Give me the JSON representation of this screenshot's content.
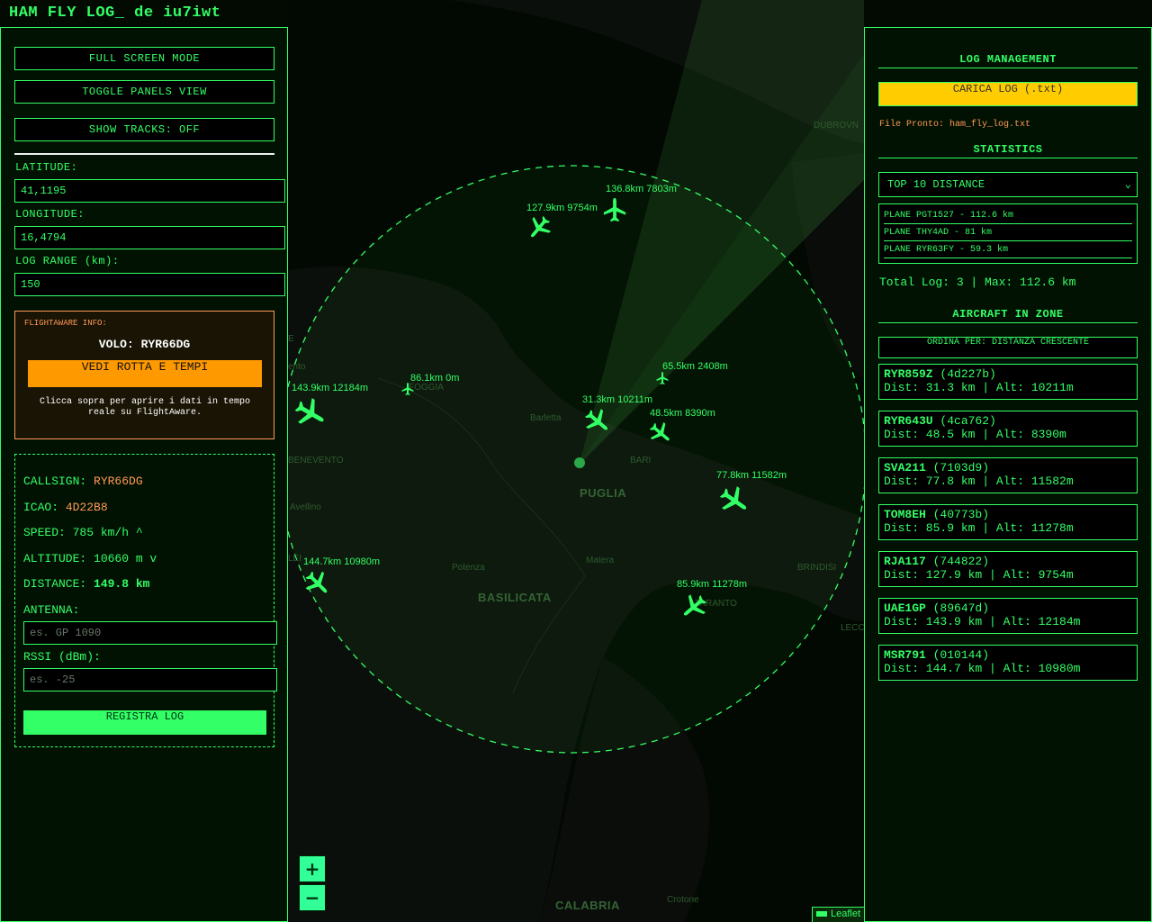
{
  "app": {
    "title": "HAM FLY LOG_ de iu7iwt"
  },
  "left": {
    "full_screen": "FULL SCREEN MODE",
    "toggle_panels": "TOGGLE PANELS VIEW",
    "show_tracks": "SHOW TRACKS: OFF",
    "latitude_label": "LATITUDE:",
    "latitude_value": "41,1195",
    "longitude_label": "LONGITUDE:",
    "longitude_value": "16,4794",
    "range_label": "LOG RANGE (km):",
    "range_value": "150",
    "flightaware": {
      "header": "FLIGHTAWARE INFO:",
      "flight": "VOLO: RYR66DG",
      "button": "VEDI ROTTA E TEMPI",
      "note": "Clicca sopra per aprire i dati in tempo reale su FlightAware."
    },
    "details": {
      "callsign_label": "CALLSIGN:",
      "callsign": "RYR66DG",
      "icao_label": "ICAO:",
      "icao": "4D22B8",
      "speed": "SPEED: 785 km/h ^",
      "altitude": "ALTITUDE: 10660 m v",
      "distance_label": "DISTANCE:",
      "distance": "149.8 km",
      "antenna_label": "ANTENNA:",
      "antenna_placeholder": "es. GP 1090",
      "rssi_label": "RSSI (dBm):",
      "rssi_placeholder": "es. -25",
      "register": "REGISTRA LOG"
    }
  },
  "map": {
    "labels": [
      "DUBROVN",
      "FOGGIA",
      "Barletta",
      "BARI",
      "PUGLIA",
      "BENEVENTO",
      "Avellino",
      "Potenza",
      "Matera",
      "BASILICATA",
      "BRINDISI",
      "TARANTO",
      "LECC",
      "CALABRIA",
      "Crotone",
      "E",
      "LEI",
      "ento"
    ],
    "planes": [
      {
        "label": "127.9km 9754m",
        "heading": 220
      },
      {
        "label": "136.8km 7803m",
        "heading": 0
      },
      {
        "label": "86.1km 0m",
        "heading": 0
      },
      {
        "label": "65.5km 2408m",
        "heading": 0
      },
      {
        "label": "143.9km 12184m",
        "heading": 120
      },
      {
        "label": "31.3km 10211m",
        "heading": 130
      },
      {
        "label": "48.5km 8390m",
        "heading": 130
      },
      {
        "label": "77.8km 11582m",
        "heading": 125
      },
      {
        "label": "144.7km 10980m",
        "heading": 135
      },
      {
        "label": "85.9km 11278m",
        "heading": 230
      }
    ],
    "zoom_in": "+",
    "zoom_out": "−",
    "attribution": "Leaflet"
  },
  "right": {
    "log_mgmt_title": "LOG MANAGEMENT",
    "load_button": "CARICA LOG (.txt)",
    "file_ready": "File Pronto: ham_fly_log.txt",
    "stats_title": "STATISTICS",
    "stats_select": "TOP 10 DISTANCE",
    "top": [
      "PLANE PGT1527 - 112.6 km",
      "PLANE THY4AD - 81 km",
      "PLANE RYR63FY - 59.3 km"
    ],
    "totals": "Total Log: 3 | Max: 112.6 km",
    "aircraft_title": "AIRCRAFT IN ZONE",
    "sort": "ORDINA PER: DISTANZA CRESCENTE",
    "aircraft": [
      {
        "callsign": "RYR859Z",
        "icao": "(4d227b)",
        "info": "Dist: 31.3 km | Alt: 10211m"
      },
      {
        "callsign": "RYR643U",
        "icao": "(4ca762)",
        "info": "Dist: 48.5 km | Alt: 8390m"
      },
      {
        "callsign": "SVA211",
        "icao": "(7103d9)",
        "info": "Dist: 77.8 km | Alt: 11582m"
      },
      {
        "callsign": "TOM8EH",
        "icao": "(40773b)",
        "info": "Dist: 85.9 km | Alt: 11278m"
      },
      {
        "callsign": "RJA117",
        "icao": "(744822)",
        "info": "Dist: 127.9 km | Alt: 9754m"
      },
      {
        "callsign": "UAE1GP",
        "icao": "(89647d)",
        "info": "Dist: 143.9 km | Alt: 12184m"
      },
      {
        "callsign": "MSR791",
        "icao": "(010144)",
        "info": "Dist: 144.7 km | Alt: 10980m"
      }
    ]
  }
}
